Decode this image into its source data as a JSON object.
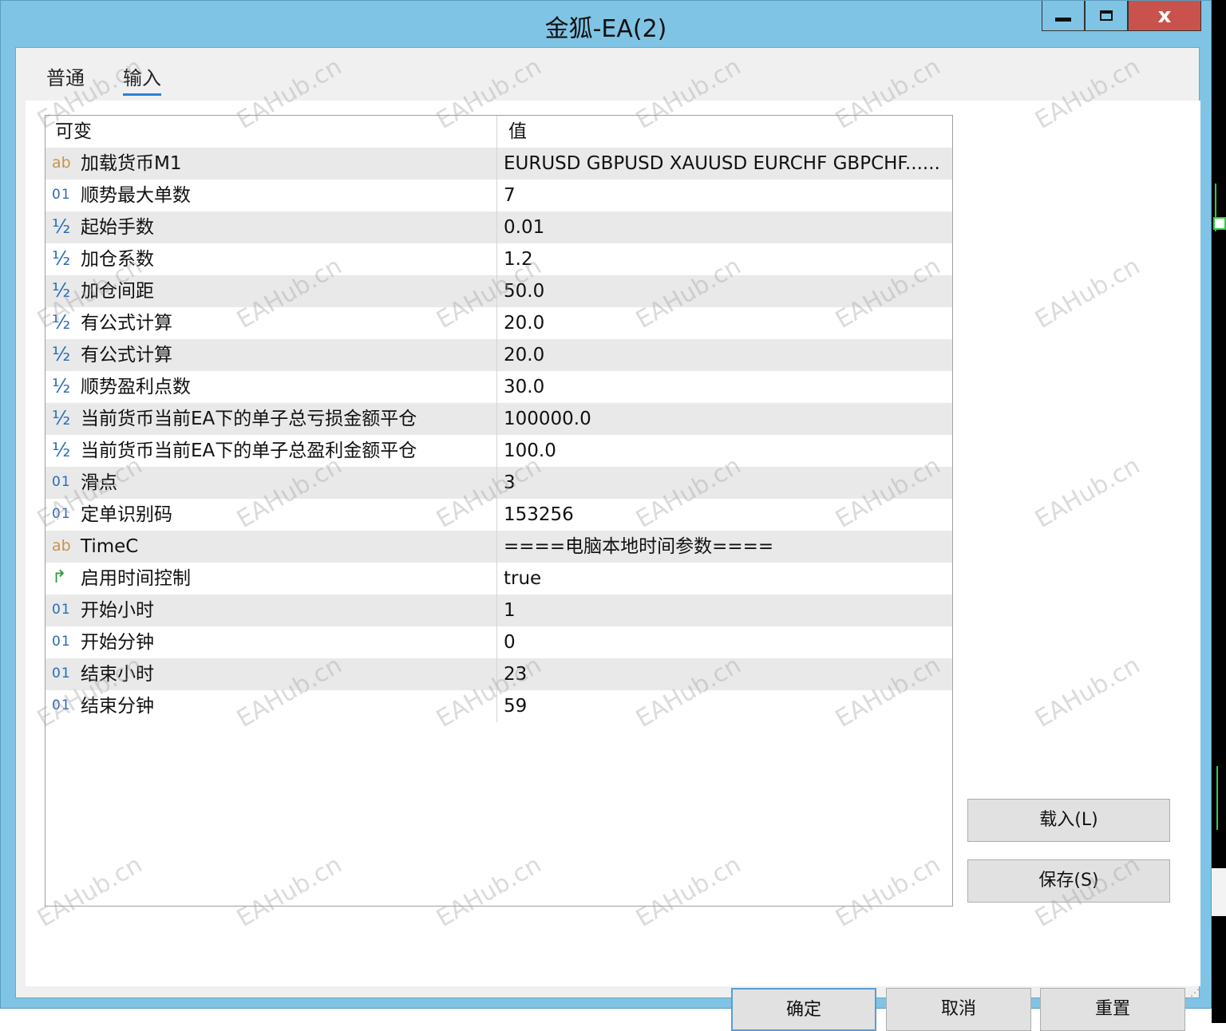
{
  "window": {
    "title": "金狐-EA(2)",
    "controls": {
      "minimize": "",
      "maximize": "",
      "close": "x"
    }
  },
  "tabs": [
    {
      "label": "普通",
      "active": false
    },
    {
      "label": "输入",
      "active": true
    }
  ],
  "grid": {
    "headers": {
      "name": "可变",
      "value": "值"
    },
    "rows": [
      {
        "type_icon": "ab",
        "icon_name": "string-type-icon",
        "name": "加载货币M1",
        "value": "EURUSD GBPUSD XAUUSD EURCHF GBPCHF......"
      },
      {
        "type_icon": "01",
        "icon_name": "integer-type-icon",
        "name": "顺势最大单数",
        "value": "7"
      },
      {
        "type_icon": "½",
        "icon_name": "double-type-icon",
        "name": "起始手数",
        "value": "0.01"
      },
      {
        "type_icon": "½",
        "icon_name": "double-type-icon",
        "name": "加仓系数",
        "value": "1.2"
      },
      {
        "type_icon": "½",
        "icon_name": "double-type-icon",
        "name": "加仓间距",
        "value": "50.0"
      },
      {
        "type_icon": "½",
        "icon_name": "double-type-icon",
        "name": "有公式计算",
        "value": "20.0"
      },
      {
        "type_icon": "½",
        "icon_name": "double-type-icon",
        "name": "有公式计算",
        "value": "20.0"
      },
      {
        "type_icon": "½",
        "icon_name": "double-type-icon",
        "name": "顺势盈利点数",
        "value": "30.0"
      },
      {
        "type_icon": "½",
        "icon_name": "double-type-icon",
        "name": "当前货币当前EA下的单子总亏损金额平仓",
        "value": "100000.0"
      },
      {
        "type_icon": "½",
        "icon_name": "double-type-icon",
        "name": "当前货币当前EA下的单子总盈利金额平仓",
        "value": "100.0"
      },
      {
        "type_icon": "01",
        "icon_name": "integer-type-icon",
        "name": "滑点",
        "value": "3"
      },
      {
        "type_icon": "01",
        "icon_name": "integer-type-icon",
        "name": "定单识别码",
        "value": "153256"
      },
      {
        "type_icon": "ab",
        "icon_name": "string-type-icon",
        "name": "TimeC",
        "value": "====电脑本地时间参数===="
      },
      {
        "type_icon": "↱",
        "icon_name": "bool-type-icon",
        "name": "启用时间控制",
        "value": "true"
      },
      {
        "type_icon": "01",
        "icon_name": "integer-type-icon",
        "name": "开始小时",
        "value": "1"
      },
      {
        "type_icon": "01",
        "icon_name": "integer-type-icon",
        "name": "开始分钟",
        "value": "0"
      },
      {
        "type_icon": "01",
        "icon_name": "integer-type-icon",
        "name": "结束小时",
        "value": "23"
      },
      {
        "type_icon": "01",
        "icon_name": "integer-type-icon",
        "name": "结束分钟",
        "value": "59"
      }
    ]
  },
  "side_buttons": {
    "load": "载入(L)",
    "save": "保存(S)"
  },
  "bottom_buttons": {
    "ok": "确定",
    "cancel": "取消",
    "reset": "重置"
  },
  "watermark": "EAHub.cn",
  "colors": {
    "titlebar": "#7fc4e5",
    "close_button": "#c9534c",
    "active_tab_underline": "#2d7fd8",
    "row_alt": "#e9e9e9",
    "int_icon": "#2a6bb7",
    "string_icon": "#c8934c",
    "bool_icon": "#2d9a3a"
  }
}
